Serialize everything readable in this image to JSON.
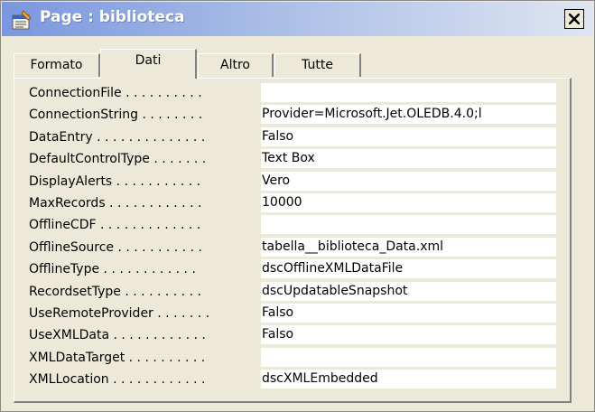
{
  "window": {
    "title": "Page : biblioteca",
    "icon": "property-sheet-icon",
    "close_icon": "close-icon"
  },
  "tabs": [
    {
      "label": "Formato",
      "active": false
    },
    {
      "label": "Dati",
      "active": true
    },
    {
      "label": "Altro",
      "active": false
    },
    {
      "label": "Tutte",
      "active": false
    }
  ],
  "properties": [
    {
      "name": "ConnectionFile . . . . . . . . . .",
      "value": ""
    },
    {
      "name": "ConnectionString . . . . . . . .",
      "value": "Provider=Microsoft.Jet.OLEDB.4.0;l"
    },
    {
      "name": "DataEntry . . . . . . . . . . . . . .",
      "value": "Falso"
    },
    {
      "name": "DefaultControlType . . . . . . .",
      "value": "Text Box"
    },
    {
      "name": "DisplayAlerts . . . . . . . . . . .",
      "value": "Vero"
    },
    {
      "name": "MaxRecords . . . . . . . . . . . .",
      "value": "10000"
    },
    {
      "name": "OfflineCDF . . . . . . . . . . . . .",
      "value": ""
    },
    {
      "name": "OfflineSource . . . . . . . . . . .",
      "value": "tabella__biblioteca_Data.xml"
    },
    {
      "name": "OfflineType . . . . . . . . . . . .",
      "value": "dscOfflineXMLDataFile"
    },
    {
      "name": "RecordsetType . . . . . . . . . .",
      "value": "dscUpdatableSnapshot"
    },
    {
      "name": "UseRemoteProvider . . . . . . .",
      "value": "Falso"
    },
    {
      "name": "UseXMLData . . . . . . . . . . . .",
      "value": "Falso"
    },
    {
      "name": "XMLDataTarget . . . . . . . . . .",
      "value": ""
    },
    {
      "name": "XMLLocation . . . . . . . . . . . .",
      "value": "dscXMLEmbedded"
    }
  ]
}
